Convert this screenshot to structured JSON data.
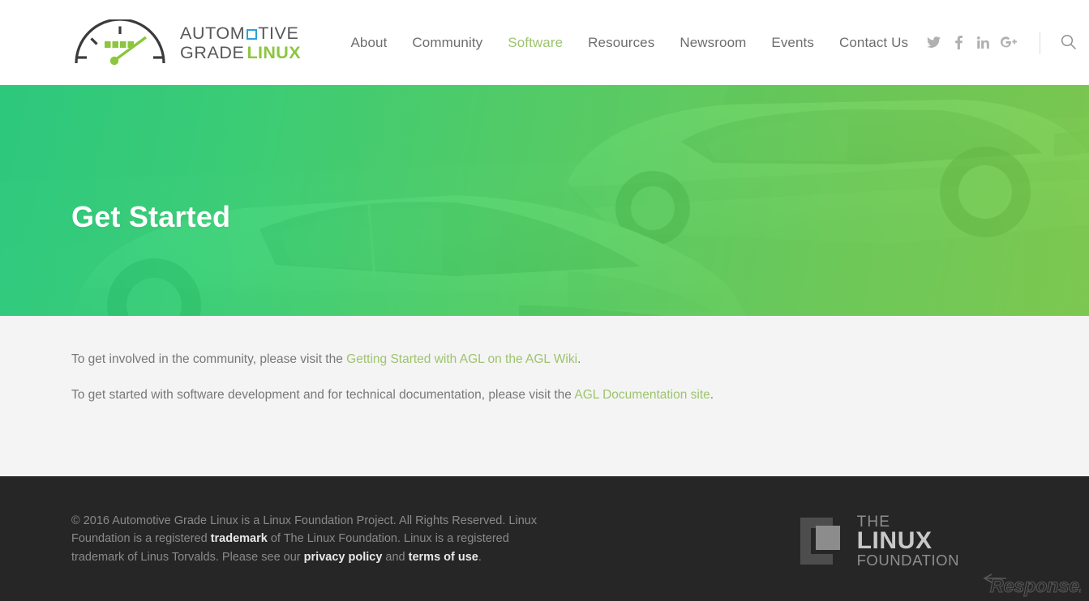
{
  "header": {
    "brand": {
      "name": "Automotive Grade Linux",
      "line1_pre": "AUTOM",
      "line1_post": "TIVE",
      "line2_grade": "GRADE",
      "line2_linux": "LINUX",
      "mark_icon": "speedometer-icon",
      "accent_square_color": "#29a3d8",
      "green": "#8cc63e"
    },
    "nav": [
      {
        "label": "About",
        "active": false
      },
      {
        "label": "Community",
        "active": false
      },
      {
        "label": "Software",
        "active": true
      },
      {
        "label": "Resources",
        "active": false
      },
      {
        "label": "Newsroom",
        "active": false
      },
      {
        "label": "Events",
        "active": false
      },
      {
        "label": "Contact Us",
        "active": false
      }
    ],
    "social": [
      {
        "name": "twitter-icon",
        "label": "Twitter"
      },
      {
        "name": "facebook-icon",
        "label": "Facebook"
      },
      {
        "name": "linkedin-icon",
        "label": "LinkedIn"
      },
      {
        "name": "googleplus-icon",
        "label": "Google Plus"
      }
    ],
    "search": {
      "icon": "search-icon",
      "label": "Search"
    }
  },
  "hero": {
    "title": "Get Started",
    "image_description": "Two cars on a road",
    "gradient_from": "#19c873",
    "gradient_to": "#74ca3f"
  },
  "content": {
    "paragraph1": {
      "before": "To get involved in the community, please visit the ",
      "link": "Getting Started with AGL on the AGL Wiki",
      "after": "."
    },
    "paragraph2": {
      "before": "To get started with software development and for technical documentation, please visit the ",
      "link": "AGL Documentation site",
      "after": "."
    },
    "link_color": "#9dc46e"
  },
  "footer": {
    "legal": {
      "part1": "© 2016 Automotive Grade Linux is a Linux Foundation Project. All Rights Reserved. Linux Foundation is a registered ",
      "link_trademark": "trademark",
      "part2": " of The Linux Foundation. Linux is a registered trademark of Linus Torvalds. Please see our ",
      "link_privacy": "privacy policy",
      "part3": " and ",
      "link_terms": "terms of use",
      "part4": "."
    },
    "lf_logo": {
      "the": "THE",
      "linux": "LINUX",
      "foundation": "FOUNDATION",
      "mark_icon": "linux-foundation-bracket-icon"
    },
    "background": "#262626"
  },
  "watermark": {
    "text": "Response.",
    "icon": "arrow-icon"
  }
}
